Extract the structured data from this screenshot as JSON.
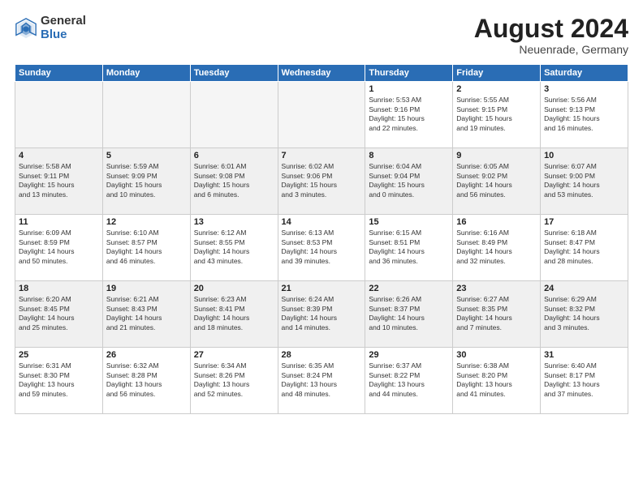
{
  "header": {
    "logo_general": "General",
    "logo_blue": "Blue",
    "month_title": "August 2024",
    "location": "Neuenrade, Germany"
  },
  "weekdays": [
    "Sunday",
    "Monday",
    "Tuesday",
    "Wednesday",
    "Thursday",
    "Friday",
    "Saturday"
  ],
  "weeks": [
    [
      {
        "day": "",
        "info": ""
      },
      {
        "day": "",
        "info": ""
      },
      {
        "day": "",
        "info": ""
      },
      {
        "day": "",
        "info": ""
      },
      {
        "day": "1",
        "info": "Sunrise: 5:53 AM\nSunset: 9:16 PM\nDaylight: 15 hours\nand 22 minutes."
      },
      {
        "day": "2",
        "info": "Sunrise: 5:55 AM\nSunset: 9:15 PM\nDaylight: 15 hours\nand 19 minutes."
      },
      {
        "day": "3",
        "info": "Sunrise: 5:56 AM\nSunset: 9:13 PM\nDaylight: 15 hours\nand 16 minutes."
      }
    ],
    [
      {
        "day": "4",
        "info": "Sunrise: 5:58 AM\nSunset: 9:11 PM\nDaylight: 15 hours\nand 13 minutes."
      },
      {
        "day": "5",
        "info": "Sunrise: 5:59 AM\nSunset: 9:09 PM\nDaylight: 15 hours\nand 10 minutes."
      },
      {
        "day": "6",
        "info": "Sunrise: 6:01 AM\nSunset: 9:08 PM\nDaylight: 15 hours\nand 6 minutes."
      },
      {
        "day": "7",
        "info": "Sunrise: 6:02 AM\nSunset: 9:06 PM\nDaylight: 15 hours\nand 3 minutes."
      },
      {
        "day": "8",
        "info": "Sunrise: 6:04 AM\nSunset: 9:04 PM\nDaylight: 15 hours\nand 0 minutes."
      },
      {
        "day": "9",
        "info": "Sunrise: 6:05 AM\nSunset: 9:02 PM\nDaylight: 14 hours\nand 56 minutes."
      },
      {
        "day": "10",
        "info": "Sunrise: 6:07 AM\nSunset: 9:00 PM\nDaylight: 14 hours\nand 53 minutes."
      }
    ],
    [
      {
        "day": "11",
        "info": "Sunrise: 6:09 AM\nSunset: 8:59 PM\nDaylight: 14 hours\nand 50 minutes."
      },
      {
        "day": "12",
        "info": "Sunrise: 6:10 AM\nSunset: 8:57 PM\nDaylight: 14 hours\nand 46 minutes."
      },
      {
        "day": "13",
        "info": "Sunrise: 6:12 AM\nSunset: 8:55 PM\nDaylight: 14 hours\nand 43 minutes."
      },
      {
        "day": "14",
        "info": "Sunrise: 6:13 AM\nSunset: 8:53 PM\nDaylight: 14 hours\nand 39 minutes."
      },
      {
        "day": "15",
        "info": "Sunrise: 6:15 AM\nSunset: 8:51 PM\nDaylight: 14 hours\nand 36 minutes."
      },
      {
        "day": "16",
        "info": "Sunrise: 6:16 AM\nSunset: 8:49 PM\nDaylight: 14 hours\nand 32 minutes."
      },
      {
        "day": "17",
        "info": "Sunrise: 6:18 AM\nSunset: 8:47 PM\nDaylight: 14 hours\nand 28 minutes."
      }
    ],
    [
      {
        "day": "18",
        "info": "Sunrise: 6:20 AM\nSunset: 8:45 PM\nDaylight: 14 hours\nand 25 minutes."
      },
      {
        "day": "19",
        "info": "Sunrise: 6:21 AM\nSunset: 8:43 PM\nDaylight: 14 hours\nand 21 minutes."
      },
      {
        "day": "20",
        "info": "Sunrise: 6:23 AM\nSunset: 8:41 PM\nDaylight: 14 hours\nand 18 minutes."
      },
      {
        "day": "21",
        "info": "Sunrise: 6:24 AM\nSunset: 8:39 PM\nDaylight: 14 hours\nand 14 minutes."
      },
      {
        "day": "22",
        "info": "Sunrise: 6:26 AM\nSunset: 8:37 PM\nDaylight: 14 hours\nand 10 minutes."
      },
      {
        "day": "23",
        "info": "Sunrise: 6:27 AM\nSunset: 8:35 PM\nDaylight: 14 hours\nand 7 minutes."
      },
      {
        "day": "24",
        "info": "Sunrise: 6:29 AM\nSunset: 8:32 PM\nDaylight: 14 hours\nand 3 minutes."
      }
    ],
    [
      {
        "day": "25",
        "info": "Sunrise: 6:31 AM\nSunset: 8:30 PM\nDaylight: 13 hours\nand 59 minutes."
      },
      {
        "day": "26",
        "info": "Sunrise: 6:32 AM\nSunset: 8:28 PM\nDaylight: 13 hours\nand 56 minutes."
      },
      {
        "day": "27",
        "info": "Sunrise: 6:34 AM\nSunset: 8:26 PM\nDaylight: 13 hours\nand 52 minutes."
      },
      {
        "day": "28",
        "info": "Sunrise: 6:35 AM\nSunset: 8:24 PM\nDaylight: 13 hours\nand 48 minutes."
      },
      {
        "day": "29",
        "info": "Sunrise: 6:37 AM\nSunset: 8:22 PM\nDaylight: 13 hours\nand 44 minutes."
      },
      {
        "day": "30",
        "info": "Sunrise: 6:38 AM\nSunset: 8:20 PM\nDaylight: 13 hours\nand 41 minutes."
      },
      {
        "day": "31",
        "info": "Sunrise: 6:40 AM\nSunset: 8:17 PM\nDaylight: 13 hours\nand 37 minutes."
      }
    ]
  ]
}
